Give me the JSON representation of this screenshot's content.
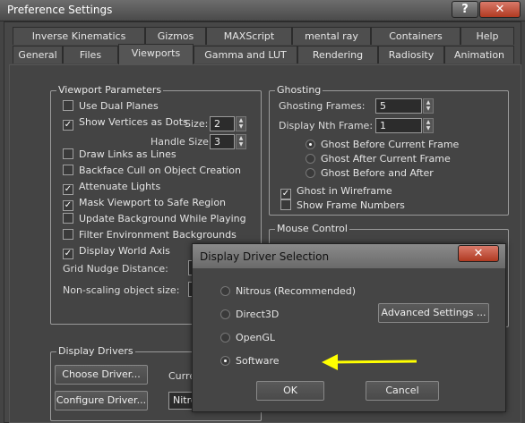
{
  "window": {
    "title": "Preference Settings",
    "help_label": "?",
    "close_label": "✕"
  },
  "tabs_row1": [
    "Inverse Kinematics",
    "Gizmos",
    "MAXScript",
    "mental ray",
    "Containers",
    "Help"
  ],
  "tabs_row2": [
    "General",
    "Files",
    "Viewports",
    "Gamma and LUT",
    "Rendering",
    "Radiosity",
    "Animation"
  ],
  "viewport_params": {
    "title": "Viewport Parameters",
    "items": [
      {
        "label": "Use Dual Planes",
        "checked": false
      },
      {
        "label": "Show Vertices as Dots",
        "checked": true
      },
      {
        "label": "Draw Links as Lines",
        "checked": false
      },
      {
        "label": "Backface Cull on Object Creation",
        "checked": false
      },
      {
        "label": "Attenuate Lights",
        "checked": true
      },
      {
        "label": "Mask Viewport to Safe Region",
        "checked": true
      },
      {
        "label": "Update Background While Playing",
        "checked": false
      },
      {
        "label": "Filter Environment Backgrounds",
        "checked": false
      },
      {
        "label": "Display World Axis",
        "checked": true
      }
    ],
    "size_label": "Size:",
    "size_value": "2",
    "handle_size_label": "Handle Size:",
    "handle_size_value": "3",
    "grid_nudge_label": "Grid Nudge Distance:",
    "nonscaling_label": "Non-scaling object size:"
  },
  "ghosting": {
    "title": "Ghosting",
    "frames_label": "Ghosting Frames:",
    "frames_value": "5",
    "nth_label": "Display Nth Frame:",
    "nth_value": "1",
    "radios": [
      {
        "label": "Ghost Before Current Frame",
        "selected": true
      },
      {
        "label": "Ghost After Current Frame",
        "selected": false
      },
      {
        "label": "Ghost Before and After",
        "selected": false
      }
    ],
    "wireframe_label": "Ghost in Wireframe",
    "wireframe_checked": true,
    "frame_numbers_label": "Show Frame Numbers",
    "frame_numbers_checked": false
  },
  "mouse_control": {
    "title": "Mouse Control"
  },
  "display_drivers": {
    "title": "Display Drivers",
    "choose_label": "Choose Driver...",
    "configure_label": "Configure Driver...",
    "current_label": "Curre",
    "current_value": "Nitro"
  },
  "dialog": {
    "title": "Display Driver Selection",
    "close_label": "✕",
    "options": [
      {
        "label": "Nitrous (Recommended)",
        "selected": false
      },
      {
        "label": "Direct3D",
        "selected": false
      },
      {
        "label": "OpenGL",
        "selected": false
      },
      {
        "label": "Software",
        "selected": true
      }
    ],
    "advanced_label": "Advanced Settings ...",
    "ok_label": "OK",
    "cancel_label": "Cancel"
  },
  "colors": {
    "arrow": "#ffff00",
    "close_red": "#c0472f"
  }
}
